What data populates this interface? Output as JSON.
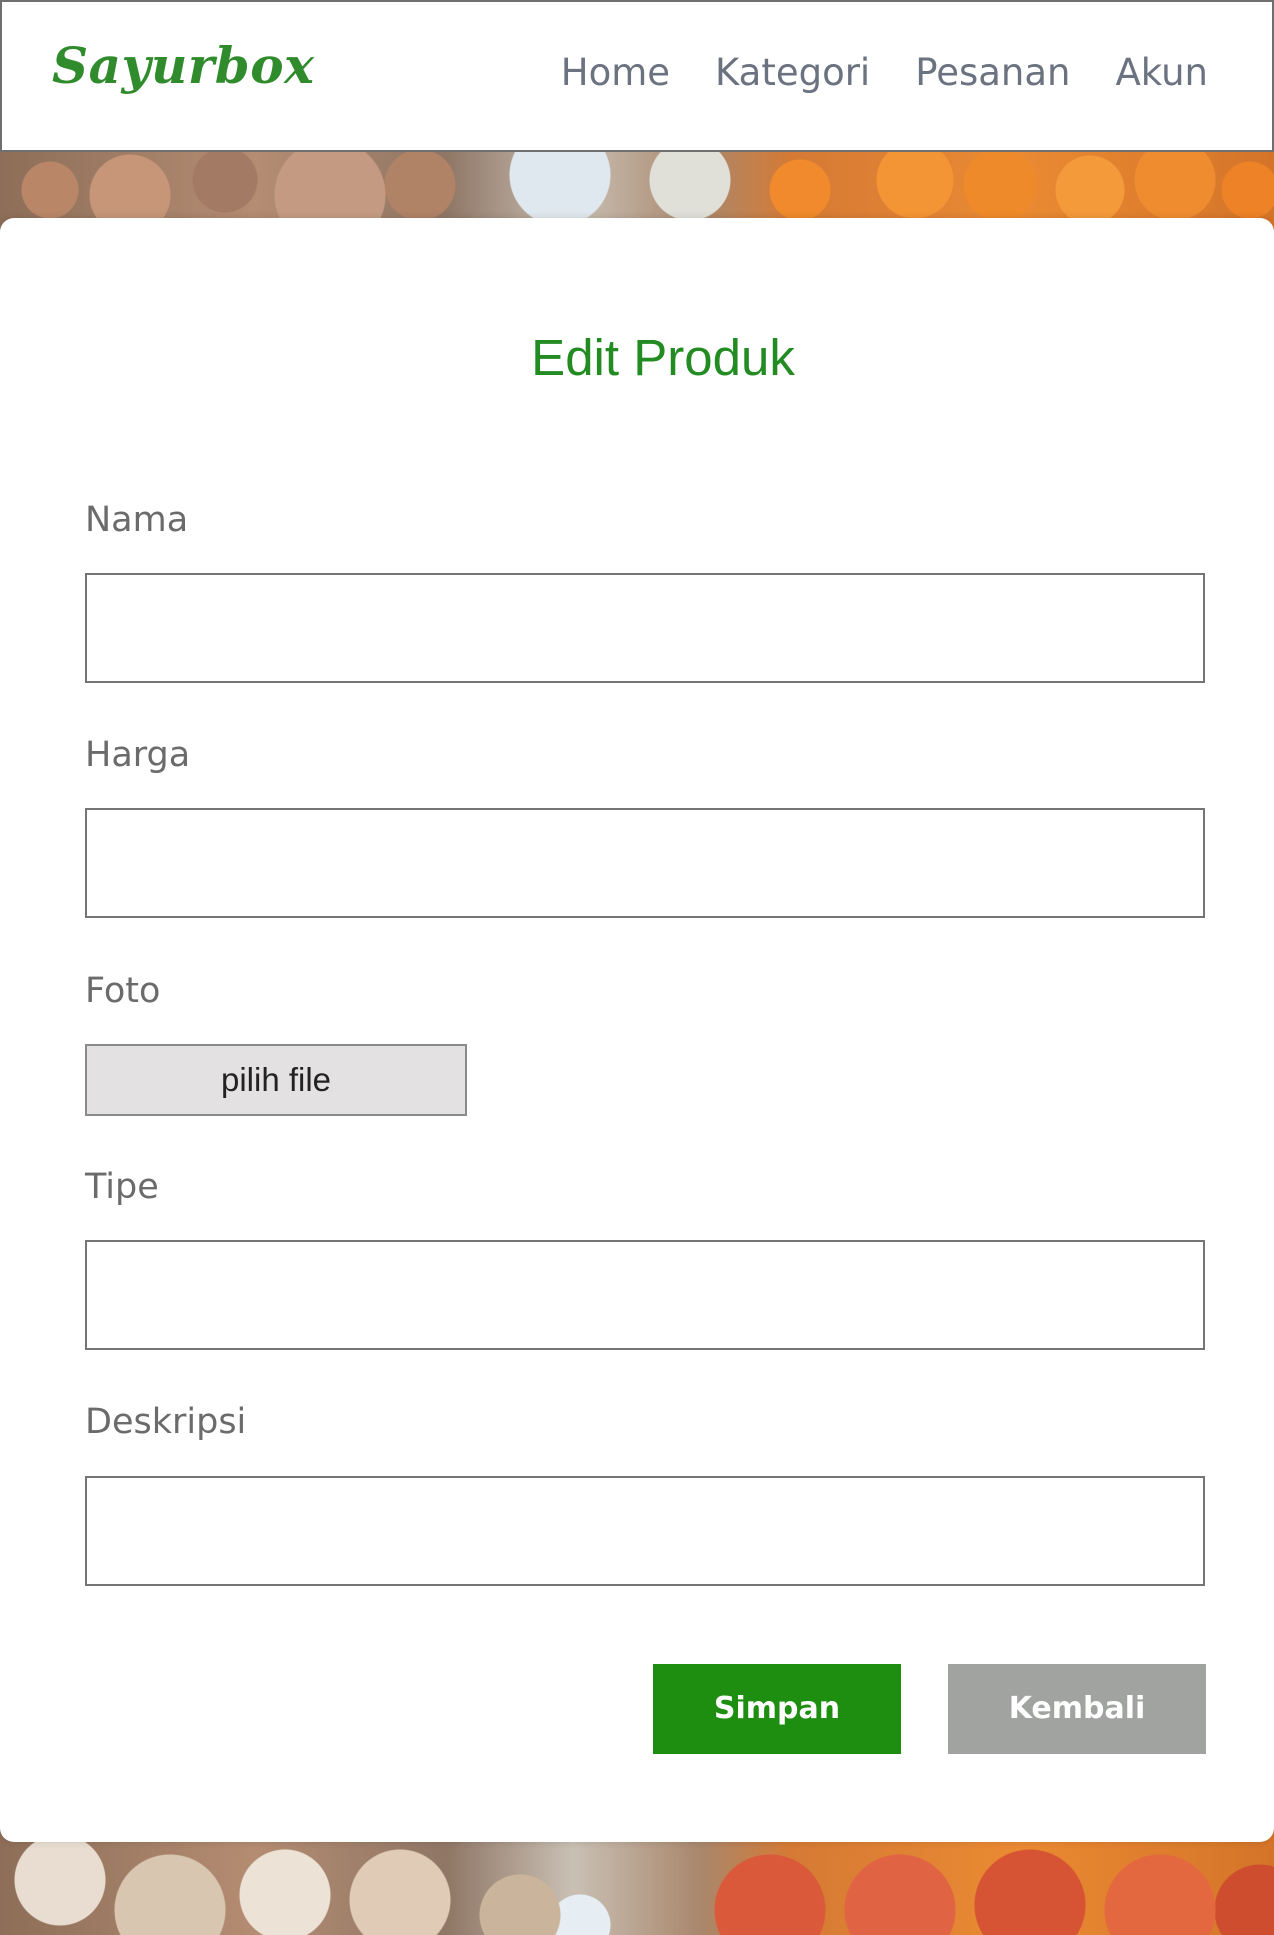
{
  "header": {
    "logo": "Sayurbox",
    "nav": [
      {
        "label": "Home"
      },
      {
        "label": "Kategori"
      },
      {
        "label": "Pesanan"
      },
      {
        "label": "Akun"
      }
    ]
  },
  "form": {
    "title": "Edit Produk",
    "fields": {
      "nama": {
        "label": "Nama",
        "value": ""
      },
      "harga": {
        "label": "Harga",
        "value": ""
      },
      "foto": {
        "label": "Foto",
        "button_label": "pilih file"
      },
      "tipe": {
        "label": "Tipe",
        "value": ""
      },
      "deskripsi": {
        "label": "Deskripsi",
        "value": ""
      }
    },
    "buttons": {
      "save": "Simpan",
      "back": "Kembali"
    }
  },
  "colors": {
    "brand_green": "#2f8b2c",
    "title_green": "#228b22",
    "save_button": "#1e8e11",
    "back_button": "#a1a3a1",
    "nav_text": "#6b7280"
  }
}
